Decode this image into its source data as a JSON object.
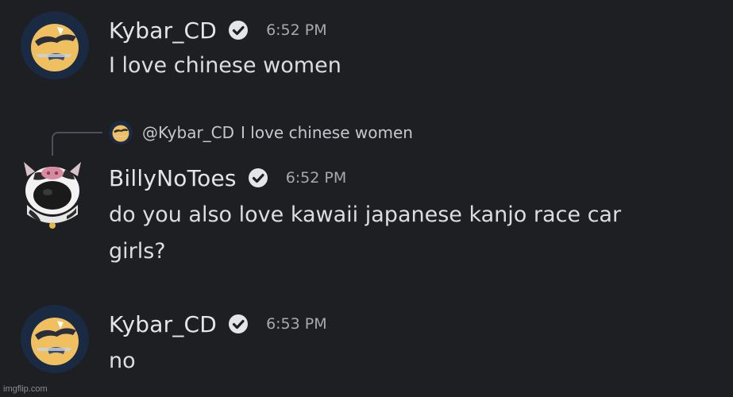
{
  "messages": [
    {
      "username": "Kybar_CD",
      "verified_icon": "check-badge-icon",
      "timestamp": "6:52 PM",
      "text": "I love chinese women",
      "avatar_icon": "moon-crane-avatar"
    },
    {
      "reply": {
        "username": "@Kybar_CD",
        "text": "I love chinese women",
        "avatar_icon": "moon-crane-avatar"
      },
      "username": "BillyNoToes",
      "verified_icon": "check-badge-icon",
      "timestamp": "6:52 PM",
      "text": "do you also love kawaii japanese kanjo race car girls?",
      "avatar_icon": "cow-avatar"
    },
    {
      "username": "Kybar_CD",
      "verified_icon": "check-badge-icon",
      "timestamp": "6:53 PM",
      "text": "no",
      "avatar_icon": "moon-crane-avatar"
    }
  ],
  "watermark": "imgflip.com",
  "colors": {
    "background": "#1e1f22",
    "username": "#e3e5e8",
    "timestamp": "#a7a9ad",
    "text": "#dbdee1",
    "reply_line": "#4e5058"
  }
}
